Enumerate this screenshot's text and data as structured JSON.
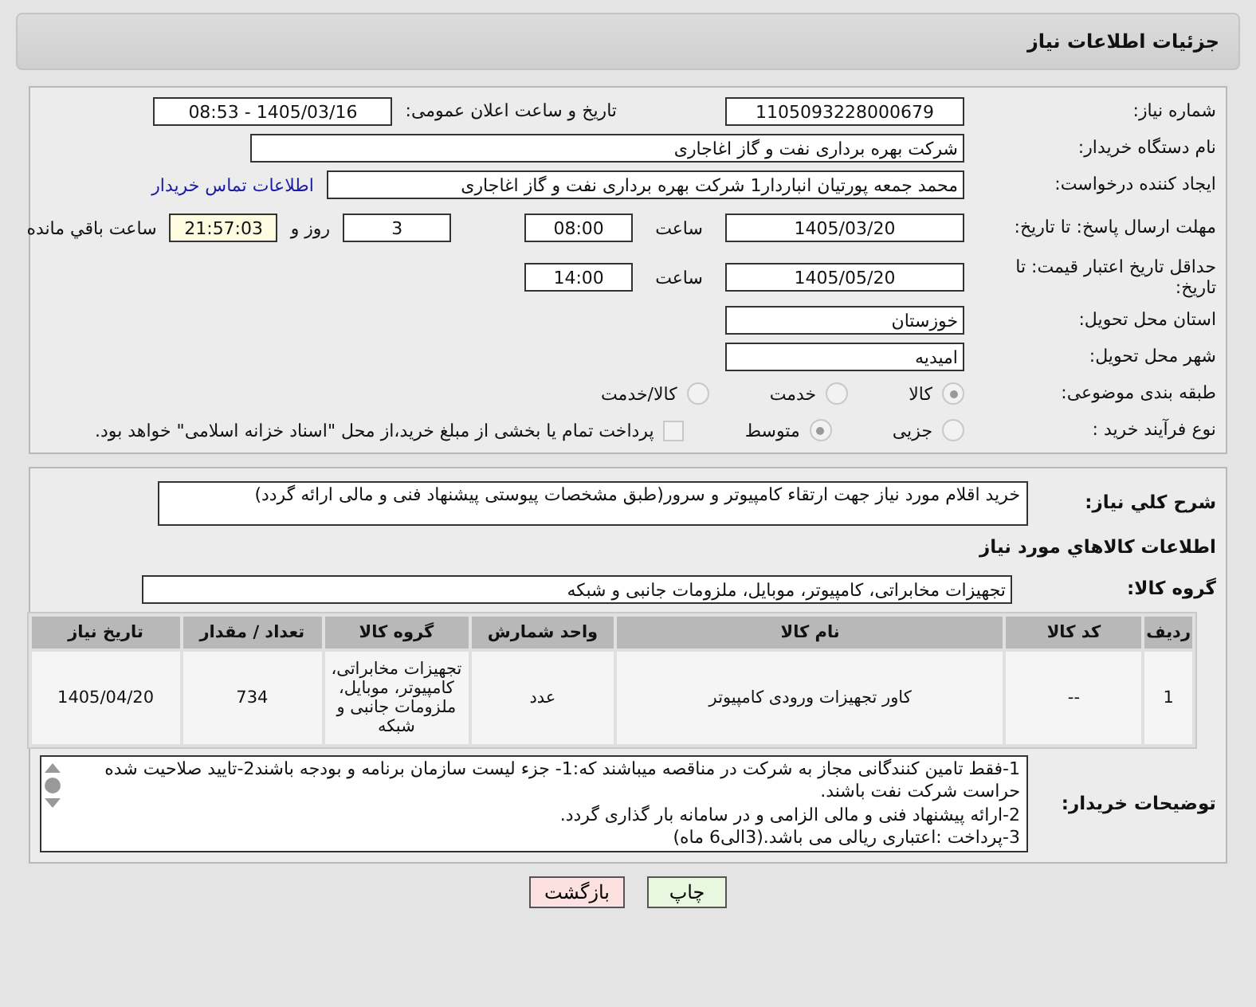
{
  "page_title": "جزئیات اطلاعات نیاز",
  "fields": {
    "need_number": {
      "label": "شماره نیاز:",
      "value": "1105093228000679"
    },
    "announce": {
      "label": "تاریخ و ساعت اعلان عمومی:",
      "value": "1405/03/16 - 08:53"
    },
    "buyer_org": {
      "label": "نام دستگاه خریدار:",
      "value": "شرکت بهره برداری نفت و گاز اغاجاری"
    },
    "creator": {
      "label": "ایجاد کننده درخواست:",
      "value": "محمد جمعه پورتیان انباردار1 شرکت بهره برداری نفت و گاز اغاجاری",
      "link": "اطلاعات تماس خریدار"
    },
    "deadline": {
      "label": "مهلت ارسال پاسخ: تا تاریخ:",
      "date": "1405/03/20",
      "time_label": "ساعت",
      "time": "08:00",
      "days": "3",
      "days_label": "روز و",
      "remaining": "21:57:03",
      "remaining_label": "ساعت باقي مانده"
    },
    "validity": {
      "label": "حداقل تاریخ اعتبار قیمت: تا تاریخ:",
      "date": "1405/05/20",
      "time_label": "ساعت",
      "time": "14:00"
    },
    "province": {
      "label": "استان محل تحویل:",
      "value": "خوزستان"
    },
    "city": {
      "label": "شهر محل تحویل:",
      "value": "امیدیه"
    }
  },
  "category": {
    "label": "طبقه بندی موضوعی:",
    "options": [
      {
        "label": "کالا",
        "selected": true
      },
      {
        "label": "خدمت",
        "selected": false
      },
      {
        "label": "کالا/خدمت",
        "selected": false
      }
    ]
  },
  "process": {
    "label": "نوع فرآیند خرید :",
    "options": [
      {
        "label": "جزیی",
        "selected": false
      },
      {
        "label": "متوسط",
        "selected": true
      }
    ],
    "payment": {
      "checked": false,
      "label": "پرداخت تمام یا بخشی از مبلغ خرید،از محل \"اسناد خزانه اسلامی\" خواهد بود."
    }
  },
  "description": {
    "label": "شرح کلي نیاز:",
    "value": "خرید اقلام مورد نیاز جهت ارتقاء کامپیوتر و سرور(طبق مشخصات پیوستی پیشنهاد فنی و مالی ارائه گردد)"
  },
  "goods_heading": "اطلاعات کالاهاي مورد نیاز",
  "goods_group": {
    "label": "گروه کالا:",
    "value": "تجهیزات مخابراتی، کامپیوتر، موبایل، ملزومات جانبی و شبکه"
  },
  "table": {
    "columns": [
      "ردیف",
      "کد کالا",
      "نام کالا",
      "واحد شمارش",
      "گروه کالا",
      "تعداد / مقدار",
      "تاریخ نیاز"
    ],
    "rows": [
      [
        "1",
        "--",
        "کاور تجهیزات ورودی کامپیوتر",
        "عدد",
        "تجهیزات مخابراتی، کامپیوتر، موبایل، ملزومات جانبی و شبکه",
        "734",
        "1405/04/20"
      ]
    ]
  },
  "buyer_notes": {
    "label": "توضیحات خریدار:",
    "lines": [
      "1-فقط تامین کنندگانی مجاز به شرکت در مناقصه میباشند که:1- جزء لیست سازمان برنامه و بودجه باشند2-تایید صلاحیت شده حراست شرکت نفت باشند.",
      "2-ارائه پیشنهاد فنی و مالی الزامی و در سامانه بار گذاری گردد.",
      "3-پرداخت :اعتباری ریالی  می باشد.(3الی6 ماه)"
    ]
  },
  "buttons": [
    {
      "label": "چاپ",
      "kind": "print"
    },
    {
      "label": "بازگشت",
      "kind": "back"
    }
  ]
}
